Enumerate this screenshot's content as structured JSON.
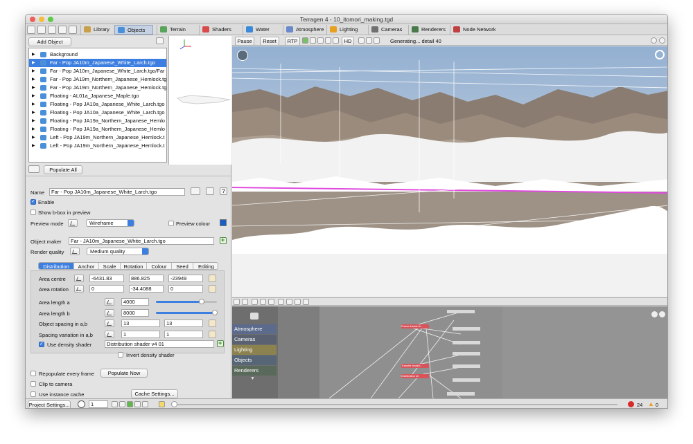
{
  "window": {
    "title": "Terragen 4 - 10_itomori_making.tgd"
  },
  "tabs": [
    {
      "label": "Library",
      "color": "#c9a04a"
    },
    {
      "label": "Objects",
      "color": "#4a90d9"
    },
    {
      "label": "Terrain",
      "color": "#5aa35a"
    },
    {
      "label": "Shaders",
      "color": "#d94a4a"
    },
    {
      "label": "Water",
      "color": "#3a8ad9"
    },
    {
      "label": "Atmosphere",
      "color": "#6a8acb"
    },
    {
      "label": "Lighting",
      "color": "#e8a020"
    },
    {
      "label": "Cameras",
      "color": "#707070"
    },
    {
      "label": "Renderers",
      "color": "#4a7a4a"
    },
    {
      "label": "Node Network",
      "color": "#c04040"
    }
  ],
  "left": {
    "add_object": "Add Object",
    "populate_all": "Populate All",
    "objects": [
      {
        "label": "Background",
        "selected": false
      },
      {
        "label": "Far - Pop JA10m_Japanese_White_Larch.tgo",
        "selected": true
      },
      {
        "label": "Far - Pop JA10m_Japanese_White_Larch.tgo/Far",
        "selected": false
      },
      {
        "label": "Far - Pop JA19m_Northern_Japanese_Hemlock.tg",
        "selected": false
      },
      {
        "label": "Far - Pop JA19m_Northern_Japanese_Hemlock.tg",
        "selected": false
      },
      {
        "label": "Floating - AL01a_Japanese_Maple.tgo",
        "selected": false
      },
      {
        "label": "Floating - Pop JA10a_Japanese_White_Larch.tgo",
        "selected": false
      },
      {
        "label": "Floating - Pop JA10a_Japanese_White_Larch.tgo",
        "selected": false
      },
      {
        "label": "Floating - Pop JA19a_Northern_Japanese_Hemlo",
        "selected": false
      },
      {
        "label": "Floating - Pop JA19a_Northern_Japanese_Hemlo",
        "selected": false
      },
      {
        "label": "Left - Pop JA19m_Northern_Japanese_Hemlock.t",
        "selected": false
      },
      {
        "label": "Left - Pop JA19m_Northern_Japanese_Hemlock.t",
        "selected": false
      }
    ]
  },
  "props": {
    "name_label": "Name",
    "name_value": "Far - Pop JA10m_Japanese_White_Larch.tgo",
    "enable": "Enable",
    "show_bbox": "Show b-box in preview",
    "preview_mode_label": "Preview mode",
    "preview_mode": "Wireframe",
    "preview_colour": "Preview colour",
    "preview_colour_hex": "#1a5fc4",
    "object_maker_label": "Object maker",
    "object_maker": "Far - JA10m_Japanese_White_Larch.tgo",
    "render_quality_label": "Render quality",
    "render_quality": "Medium quality",
    "subtabs": [
      "Distribution",
      "Anchor",
      "Scale",
      "Rotation",
      "Colour",
      "Seed",
      "Editing"
    ],
    "area_centre": {
      "label": "Area centre",
      "x": "-6431.83",
      "y": "886.825",
      "z": "-23949"
    },
    "area_rotation": {
      "label": "Area rotation",
      "x": "0",
      "y": "-34.4088",
      "z": "0"
    },
    "area_length_a": {
      "label": "Area length a",
      "value": "4000",
      "slider": 0.75
    },
    "area_length_b": {
      "label": "Area length b",
      "value": "8000",
      "slider": 0.97
    },
    "object_spacing": {
      "label": "Object spacing in a,b",
      "a": "13",
      "b": "13"
    },
    "spacing_variation": {
      "label": "Spacing variation in a,b",
      "a": "1",
      "b": "1"
    },
    "use_density": "Use density shader",
    "density_shader": "Distribution shader v4 01",
    "invert_density": "Invert density shader",
    "repopulate": "Repopulate every frame",
    "populate_now": "Populate Now",
    "clip_to_camera": "Clip to camera",
    "use_instance_cache": "Use instance cache",
    "cache_settings": "Cache Settings..."
  },
  "viewport": {
    "pause": "Pause",
    "reset": "Reset",
    "rtp": "RTP",
    "hd": "HD",
    "status": "Generating... detail 40",
    "highlight_color": "#e04ae0"
  },
  "nodes": {
    "categories": [
      {
        "label": "Atmosphere",
        "color": "#5c6a8c"
      },
      {
        "label": "Cameras",
        "color": "#5a6272"
      },
      {
        "label": "Lighting",
        "color": "#8c8250"
      },
      {
        "label": "Objects",
        "color": "#566676"
      },
      {
        "label": "Renderers",
        "color": "#5a6a5a"
      }
    ],
    "items": [
      {
        "label": "Power fractal sh",
        "color": "#d9535a"
      },
      {
        "label": "Transfer Invalid",
        "color": "#d9535a"
      },
      {
        "label": "Distribution sh",
        "color": "#d9535a"
      }
    ]
  },
  "bottom": {
    "project_settings": "Project Settings...",
    "frame": "1",
    "errors": "24",
    "warnings": "0"
  }
}
